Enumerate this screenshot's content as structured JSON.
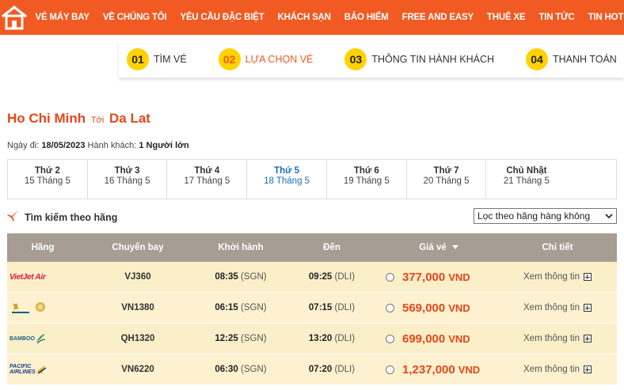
{
  "nav": {
    "items": [
      "VÉ MÁY BAY",
      "VỀ CHÚNG TÔI",
      "YÊU CẦU ĐẶC BIỆT",
      "KHÁCH SẠN",
      "BẢO HIỂM",
      "FREE AND EASY",
      "THUÊ XE",
      "TIN TỨC",
      "TIN HOT",
      "TH"
    ]
  },
  "steps": [
    {
      "num": "01",
      "label": "TÌM VÉ"
    },
    {
      "num": "02",
      "label": "LỰA CHỌN VÉ"
    },
    {
      "num": "03",
      "label": "THÔNG TIN HÀNH KHÁCH"
    },
    {
      "num": "04",
      "label": "THANH TOÁN"
    }
  ],
  "route": {
    "from": "Ho Chi Minh",
    "to_word": "Tới",
    "to": "Da Lat"
  },
  "info": {
    "date_label": "Ngày đi:",
    "date": "18/05/2023",
    "pax_label": "Hành khách:",
    "pax": "1 Người lớn"
  },
  "dates": [
    {
      "dow": "Thứ 2",
      "dm": "15 Tháng 5"
    },
    {
      "dow": "Thứ 3",
      "dm": "16 Tháng 5"
    },
    {
      "dow": "Thứ 4",
      "dm": "17 Tháng 5"
    },
    {
      "dow": "Thứ 5",
      "dm": "18 Tháng 5"
    },
    {
      "dow": "Thứ 6",
      "dm": "19 Tháng 5"
    },
    {
      "dow": "Thứ 7",
      "dm": "20 Tháng 5"
    },
    {
      "dow": "Chủ Nhật",
      "dm": "21 Tháng 5"
    }
  ],
  "airline_search": {
    "label": "Tìm kiếm theo hãng"
  },
  "filter": {
    "value": "Lọc theo hãng hàng không"
  },
  "table": {
    "headers": {
      "airline": "Hãng",
      "flight": "Chuyến bay",
      "depart": "Khởi hành",
      "arrive": "Đến",
      "price": "Giá vé",
      "detail": "Chi tiết"
    },
    "rows": [
      {
        "airline": "Vietjet Air",
        "flight": "VJ360",
        "depart_time": "08:35",
        "depart_ap": "(SGN)",
        "arrive_time": "09:25",
        "arrive_ap": "(DLI)",
        "price": "377,000",
        "currency": "VND",
        "detail": "Xem thông tin"
      },
      {
        "airline": "Vietnam Airlines",
        "flight": "VN1380",
        "depart_time": "06:15",
        "depart_ap": "(SGN)",
        "arrive_time": "07:15",
        "arrive_ap": "(DLI)",
        "price": "569,000",
        "currency": "VND",
        "detail": "Xem thông tin"
      },
      {
        "airline": "Bamboo Airways",
        "flight": "QH1320",
        "depart_time": "12:25",
        "depart_ap": "(SGN)",
        "arrive_time": "13:20",
        "arrive_ap": "(DLI)",
        "price": "699,000",
        "currency": "VND",
        "detail": "Xem thông tin"
      },
      {
        "airline": "Pacific Airlines",
        "flight": "VN6220",
        "depart_time": "06:30",
        "depart_ap": "(SGN)",
        "arrive_time": "07:20",
        "arrive_ap": "(DLI)",
        "price": "1,237,000",
        "currency": "VND",
        "detail": "Xem thông tin"
      }
    ]
  },
  "logos": {
    "vietjet": "VietJet Air",
    "bamboo": "BAMBOO",
    "pacific_1": "PACIFIC",
    "pacific_2": "AIRLINES"
  },
  "colors": {
    "brand": "#f15a22",
    "step_badge": "#ffd200",
    "price": "#e8461b",
    "selected_date": "#1a6fb5",
    "row_bg": "#fdf1cf",
    "header_bg": "#a69d93"
  }
}
